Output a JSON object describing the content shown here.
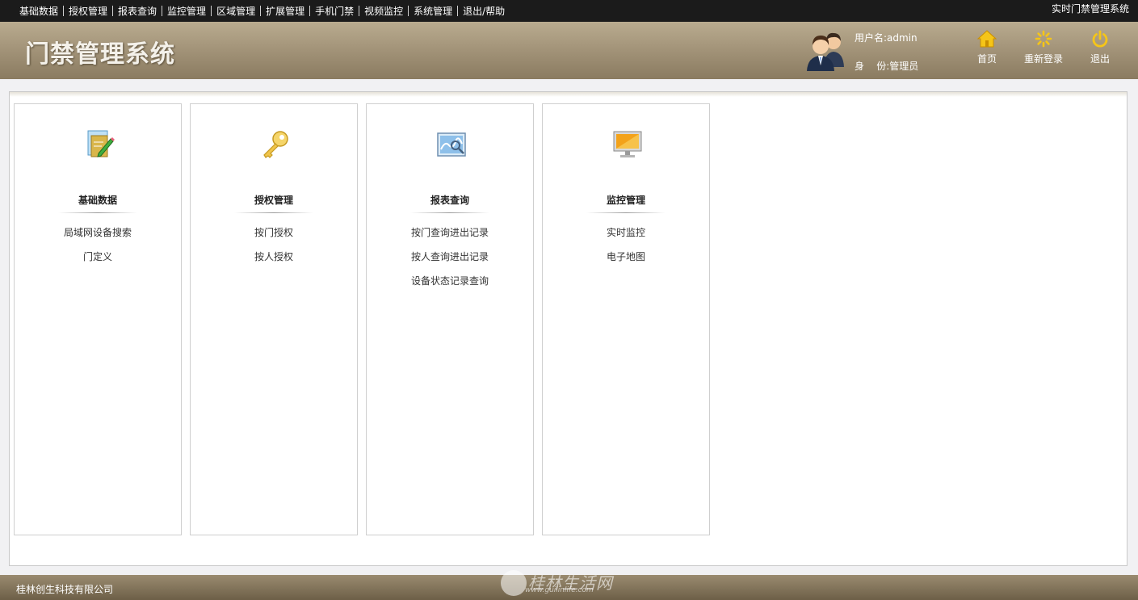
{
  "top_nav": {
    "items": [
      "基础数据",
      "授权管理",
      "报表查询",
      "监控管理",
      "区域管理",
      "扩展管理",
      "手机门禁",
      "视频监控",
      "系统管理",
      "退出/帮助"
    ],
    "system_name": "实时门禁管理系统"
  },
  "header": {
    "title": "门禁管理系统",
    "user_line": "用户名:admin",
    "role_line": "身    份:管理员",
    "buttons": {
      "home": "首页",
      "relogin": "重新登录",
      "logout": "退出"
    }
  },
  "modules": [
    {
      "title": "基础数据",
      "icon": "edit-document-icon",
      "links": [
        "局域网设备搜索",
        "门定义"
      ]
    },
    {
      "title": "授权管理",
      "icon": "key-icon",
      "links": [
        "按门授权",
        "按人授权"
      ]
    },
    {
      "title": "报表查询",
      "icon": "chart-report-icon",
      "links": [
        "按门查询进出记录",
        "按人查询进出记录",
        "设备状态记录查询"
      ]
    },
    {
      "title": "监控管理",
      "icon": "monitor-icon",
      "links": [
        "实时监控",
        "电子地图"
      ]
    }
  ],
  "footer": {
    "company": "桂林创生科技有限公司",
    "watermark_name": "桂林生活网",
    "watermark_url": "www.guilinlife.com"
  },
  "colors": {
    "top_bar": "#1b1b1b",
    "header_gradient_top": "#b9ab8f",
    "header_gradient_bottom": "#8a7b60",
    "icon_yellow": "#f5c518"
  }
}
